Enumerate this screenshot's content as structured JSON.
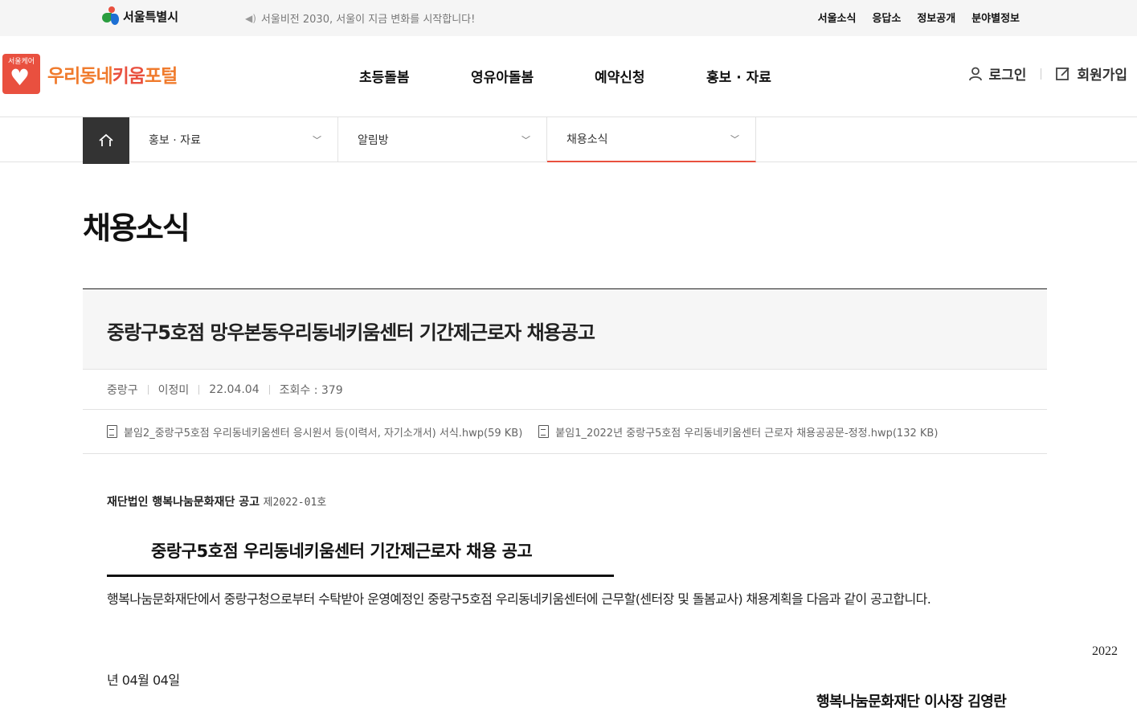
{
  "topbar": {
    "seoul_logo_text": "서울특별시",
    "notice": "서울비전 2030, 서울이 지금 변화를 시작합니다!",
    "links": [
      "서울소식",
      "응답소",
      "정보공개",
      "분야별정보"
    ]
  },
  "header": {
    "care_badge": "서울케어",
    "brand_part1": "우리동네",
    "brand_part2": "키움",
    "brand_part3": "포털",
    "gnb": [
      "초등돌봄",
      "영유아돌봄",
      "예약신청",
      "홍보 · 자료"
    ],
    "login": "로그인",
    "signup": "회원가입"
  },
  "lnb": {
    "depth1": "홍보 · 자료",
    "depth2": "알림방",
    "depth3": "채용소식"
  },
  "page_title": "채용소식",
  "article": {
    "title": "중랑구5호점 망우본동우리동네키움센터 기간제근로자 채용공고",
    "region": "중랑구",
    "author": "이정미",
    "date": "22.04.04",
    "views": "조회수 : 379",
    "attachments": [
      "붙임2_중랑구5호점 우리동네키움센터 응시원서 등(이력서, 자기소개서) 서식.hwp(59 KB)",
      "붙임1_2022년 중랑구5호점 우리동네키움센터 근로자 채용공공문-정정.hwp(132 KB)"
    ]
  },
  "content": {
    "org": "재단법인 행복나눔문화재단 공고",
    "notice_no": "제2022-01호",
    "heading": "중랑구5호점 우리동네키움센터 기간제근로자 채용 공고",
    "paragraph": "행복나눔문화재단에서 중랑구청으로부터 수탁받아 운영예정인 중랑구5호점 우리동네키움센터에 근무할(센터장 및 돌봄교사) 채용계획을 다음과 같이 공고합니다.",
    "year": "2022",
    "date_rest": "년 04월 04일",
    "signature": "행복나눔문화재단 이사장 김영란"
  },
  "colors": {
    "accent": "#e9503f",
    "brand_orange": "#f07b2d",
    "home_bg": "#333333"
  }
}
